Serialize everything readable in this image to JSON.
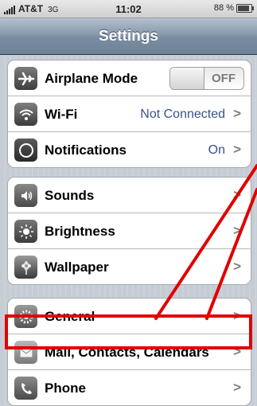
{
  "status_bar": {
    "carrier": "AT&T",
    "network": "3G",
    "time": "11:02",
    "battery": "88 %",
    "battery_level": 0.88
  },
  "nav": {
    "title": "Settings"
  },
  "groups": [
    {
      "rows": [
        {
          "label": "Airplane Mode",
          "icon": "airplane-icon",
          "toggle": "OFF"
        },
        {
          "label": "Wi-Fi",
          "icon": "wifi-icon",
          "value": "Not Connected",
          "chevron": ">"
        },
        {
          "label": "Notifications",
          "icon": "notifications-icon",
          "value": "On",
          "chevron": ">"
        }
      ]
    },
    {
      "rows": [
        {
          "label": "Sounds",
          "icon": "speaker-icon",
          "chevron": ">"
        },
        {
          "label": "Brightness",
          "icon": "sun-icon",
          "chevron": ">"
        },
        {
          "label": "Wallpaper",
          "icon": "flower-icon",
          "chevron": ">"
        }
      ]
    },
    {
      "rows": [
        {
          "label": "General",
          "icon": "gears-icon",
          "chevron": ">"
        },
        {
          "label": "Mail, Contacts, Calendars",
          "icon": "envelope-icon",
          "chevron": ">"
        },
        {
          "label": "Phone",
          "icon": "phone-icon",
          "chevron": ">"
        }
      ]
    }
  ],
  "colors": {
    "highlight": "#e00000",
    "value_text": "#385487"
  }
}
